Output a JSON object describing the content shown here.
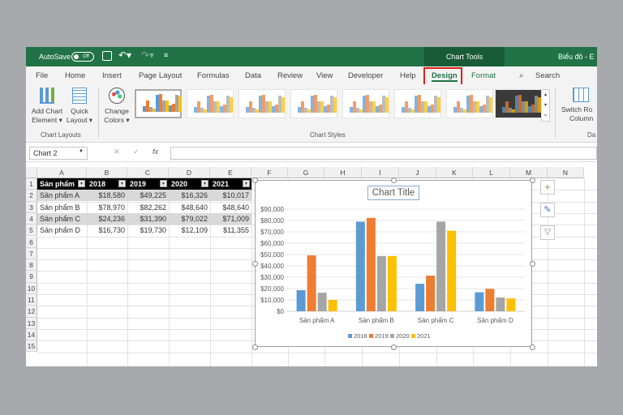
{
  "titlebar": {
    "autosave_label": "AutoSave",
    "autosave_state": "Off",
    "context_tab": "Chart Tools",
    "file_title": "Biểu đồ - E"
  },
  "tabs": [
    "File",
    "Home",
    "Insert",
    "Page Layout",
    "Formulas",
    "Data",
    "Review",
    "View",
    "Developer",
    "Help",
    "Design",
    "Format"
  ],
  "active_tab": "Design",
  "search_label": "Search",
  "ribbon": {
    "add_chart_element": [
      "Add Chart",
      "Element ▾"
    ],
    "quick_layout": [
      "Quick",
      "Layout ▾"
    ],
    "change_colors": [
      "Change",
      "Colors ▾"
    ],
    "switch_row_column": [
      "Switch Ro",
      "Column"
    ],
    "groups": {
      "chart_layouts": "Chart Layouts",
      "chart_styles": "Chart Styles",
      "data": "Da"
    }
  },
  "formula_bar": {
    "name_box": "Chart 2",
    "cancel": "✕",
    "enter": "✓",
    "fx": "fx",
    "value": ""
  },
  "columns": [
    "A",
    "B",
    "C",
    "D",
    "E",
    "F",
    "G",
    "H",
    "I",
    "J",
    "K",
    "L",
    "M",
    "N"
  ],
  "rows": [
    "1",
    "2",
    "3",
    "4",
    "5",
    "6",
    "7",
    "8",
    "9",
    "10",
    "11",
    "12",
    "13",
    "14",
    "15"
  ],
  "table": {
    "headers": [
      "Sản phẩm",
      "2018",
      "2019",
      "2020",
      "2021"
    ],
    "rows": [
      [
        "Sản phẩm A",
        "$18,580",
        "$49,225",
        "$16,326",
        "$10,017"
      ],
      [
        "Sản phẩm B",
        "$78,970",
        "$82,262",
        "$48,640",
        "$48,640"
      ],
      [
        "Sản phẩm C",
        "$24,236",
        "$31,390",
        "$79,022",
        "$71,009"
      ],
      [
        "Sản phẩm D",
        "$16,730",
        "$19,730",
        "$12,109",
        "$11,355"
      ]
    ]
  },
  "chart_data": {
    "type": "bar",
    "title": "Chart Title",
    "categories": [
      "Sản phẩm A",
      "Sản phẩm B",
      "Sản phẩm C",
      "Sản phẩm D"
    ],
    "series": [
      {
        "name": "2018",
        "color": "#5b9bd5",
        "values": [
          18580,
          78970,
          24236,
          16730
        ]
      },
      {
        "name": "2019",
        "color": "#ed7d31",
        "values": [
          49225,
          82262,
          31390,
          19730
        ]
      },
      {
        "name": "2020",
        "color": "#a5a5a5",
        "values": [
          16326,
          48640,
          79022,
          12109
        ]
      },
      {
        "name": "2021",
        "color": "#ffc000",
        "values": [
          10017,
          48640,
          71009,
          11355
        ]
      }
    ],
    "yticks": [
      "$0",
      "$10,000",
      "$20,000",
      "$30,000",
      "$40,000",
      "$50,000",
      "$60,000",
      "$70,000",
      "$80,000",
      "$90,000"
    ],
    "ylim": [
      0,
      90000
    ],
    "grid": true,
    "legend": "bottom"
  },
  "colors": {
    "excel_green": "#217346",
    "highlight": "#e0201b"
  }
}
